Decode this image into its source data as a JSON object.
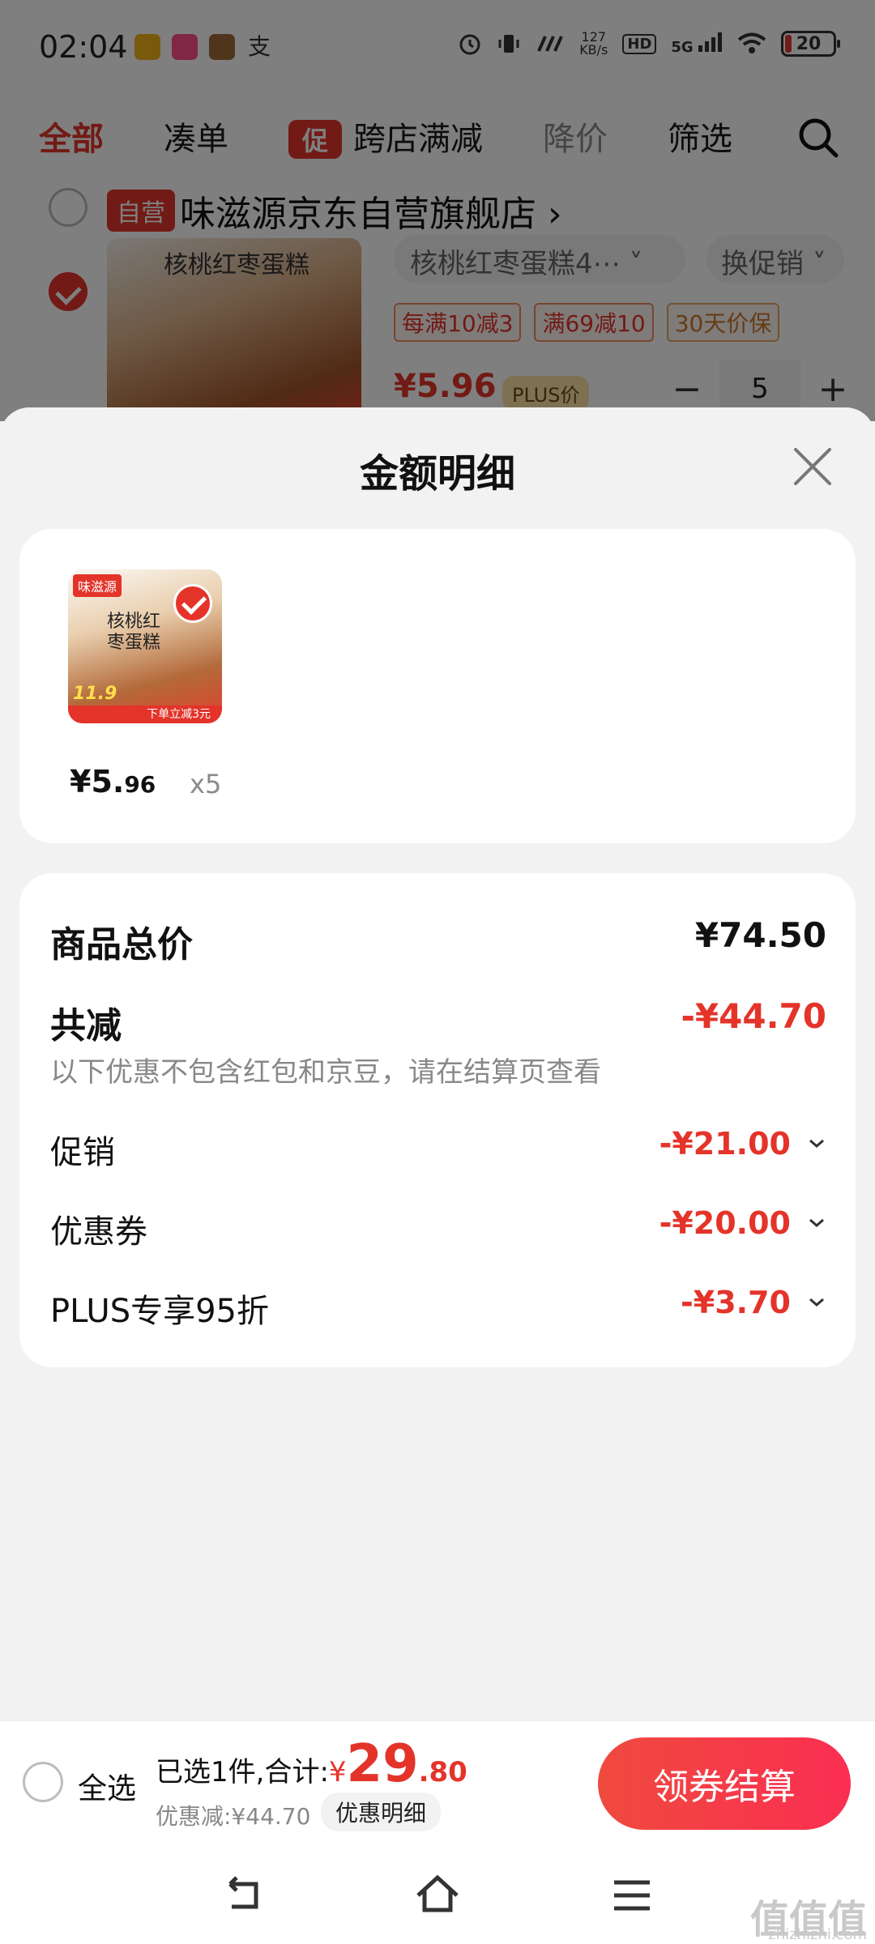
{
  "status_bar": {
    "time": "02:04",
    "app_icon_text": "支",
    "speed_value": "127",
    "speed_unit": "KB/s",
    "hd": "HD",
    "network": "5G",
    "battery": "20"
  },
  "tabs": [
    {
      "label": "全部"
    },
    {
      "label": "凑单"
    },
    {
      "label": "跨店满减",
      "tag": "促"
    },
    {
      "label": "降价"
    },
    {
      "label": "筛选"
    }
  ],
  "store": {
    "tag": "自营",
    "name": "味滋源京东自营旗舰店 ›"
  },
  "background_product": {
    "image_label": "核桃红枣蛋糕",
    "title": "核桃红枣蛋糕4⋯ ˅",
    "promo_switch": "换促销 ˅",
    "coupons": [
      "每满10减3",
      "满69减10",
      "30天价保"
    ],
    "price": "¥5.96",
    "plus_badge": "PLUS价",
    "quantity": "5",
    "minus": "−",
    "plus": "+"
  },
  "sheet": {
    "title": "金额明细",
    "item": {
      "thumb_brand": "味滋源",
      "thumb_label": "核桃红枣蛋糕",
      "thumb_price": "11.9",
      "thumb_bottom": "下单立减3元",
      "price_int": "¥5.",
      "price_dec": "96",
      "qty": "x5"
    },
    "details": {
      "total_label": "商品总价",
      "total_value": "¥74.50",
      "reduce_label": "共减",
      "reduce_value": "-¥44.70",
      "reduce_note": "以下优惠不包含红包和京豆，请在结算页查看",
      "rows": [
        {
          "label": "促销",
          "value": "-¥21.00"
        },
        {
          "label": "优惠券",
          "value": "-¥20.00"
        },
        {
          "label": "PLUS专享95折",
          "value": "-¥3.70"
        }
      ]
    }
  },
  "bottom_bar": {
    "select_all": "全选",
    "summary_prefix": "已选1件,合计:",
    "currency": "¥",
    "total_int": "29",
    "total_dec": ".80",
    "discount": "优惠减:¥44.70",
    "detail_chip": "优惠明细",
    "checkout": "领券结算"
  },
  "watermark": {
    "text": "值值值",
    "sub": "zhizhizhi.com"
  },
  "colors": {
    "accent": "#e4342a",
    "checkout_gradient_start": "#ef4a3e",
    "checkout_gradient_end": "#fb2e52"
  }
}
